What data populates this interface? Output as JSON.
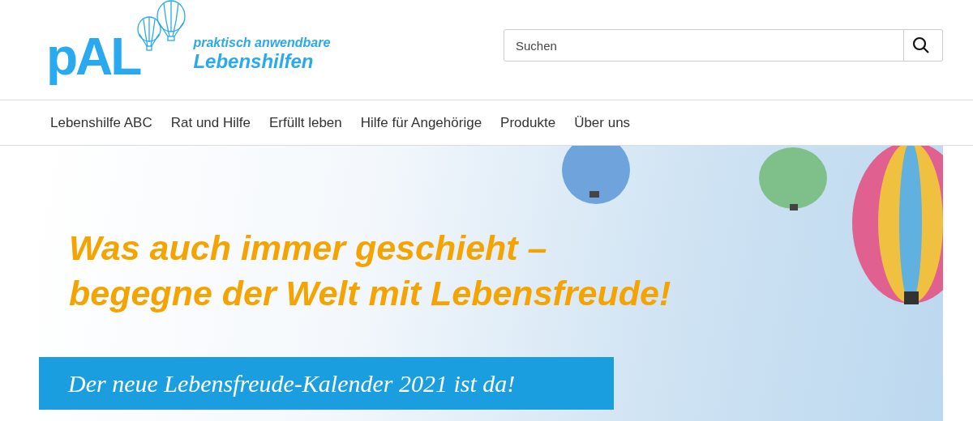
{
  "logo": {
    "wordmark": "pAL",
    "tagline": [
      "praktisch anwendbare",
      "Lebenshilfen"
    ]
  },
  "search": {
    "placeholder": "Suchen"
  },
  "nav": [
    "Lebenshilfe ABC",
    "Rat und Hilfe",
    "Erfüllt leben",
    "Hilfe für Angehörige",
    "Produkte",
    "Über uns"
  ],
  "hero": {
    "headline": [
      "Was auch immer geschieht –",
      "begegne der Welt mit Lebensfreude!"
    ],
    "cta": "Der neue Lebensfreude-Kalender 2021 ist da!"
  }
}
